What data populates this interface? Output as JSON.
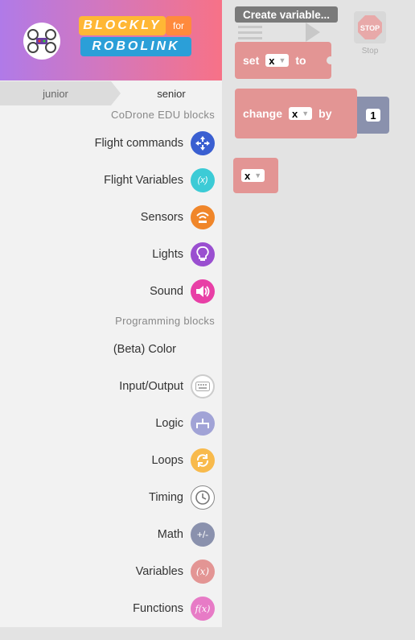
{
  "header": {
    "logo_top": "BLOCKLY",
    "logo_for": "for",
    "logo_bottom": "ROBOLINK"
  },
  "tabs": {
    "junior": "junior",
    "senior": "senior"
  },
  "sections": {
    "codrone": "CoDrone EDU blocks",
    "programming": "Programming blocks"
  },
  "categories": [
    {
      "label": "Flight commands",
      "color": "#3a5fd1",
      "icon": "drone-arrows-icon"
    },
    {
      "label": "Flight Variables",
      "color": "#3ccbd6",
      "icon": "flight-variable-icon",
      "glyph": "(x)"
    },
    {
      "label": "Sensors",
      "color": "#f0862a",
      "icon": "sensor-wave-icon"
    },
    {
      "label": "Lights",
      "color": "#9a4fd0",
      "icon": "lightbulb-icon"
    },
    {
      "label": "Sound",
      "color": "#e83fa6",
      "icon": "speaker-icon"
    },
    {
      "label": "(Beta) Color",
      "color": "",
      "icon": ""
    },
    {
      "label": "Input/Output",
      "color": "#cccccc",
      "icon": "keyboard-icon"
    },
    {
      "label": "Logic",
      "color": "#a1a3d6",
      "icon": "logic-branch-icon"
    },
    {
      "label": "Loops",
      "color": "#f8ba4c",
      "icon": "loop-arrows-icon"
    },
    {
      "label": "Timing",
      "color": "#ffffff",
      "icon": "clock-icon"
    },
    {
      "label": "Math",
      "color": "#8a91ad",
      "icon": "plus-minus-icon",
      "glyph": "+/-"
    },
    {
      "label": "Variables",
      "color": "#e39594",
      "icon": "variable-icon",
      "glyph": "(x)"
    },
    {
      "label": "Functions",
      "color": "#e77bc6",
      "icon": "function-icon",
      "glyph": "f(x)"
    }
  ],
  "workspace": {
    "create_variable": "Create variable...",
    "stop_icon_text": "STOP",
    "stop_label": "Stop",
    "blocks": {
      "set_label": "set",
      "set_var": "x",
      "set_to": "to",
      "change_label": "change",
      "change_var": "x",
      "change_by": "by",
      "change_value": "1",
      "getter_var": "x"
    }
  }
}
